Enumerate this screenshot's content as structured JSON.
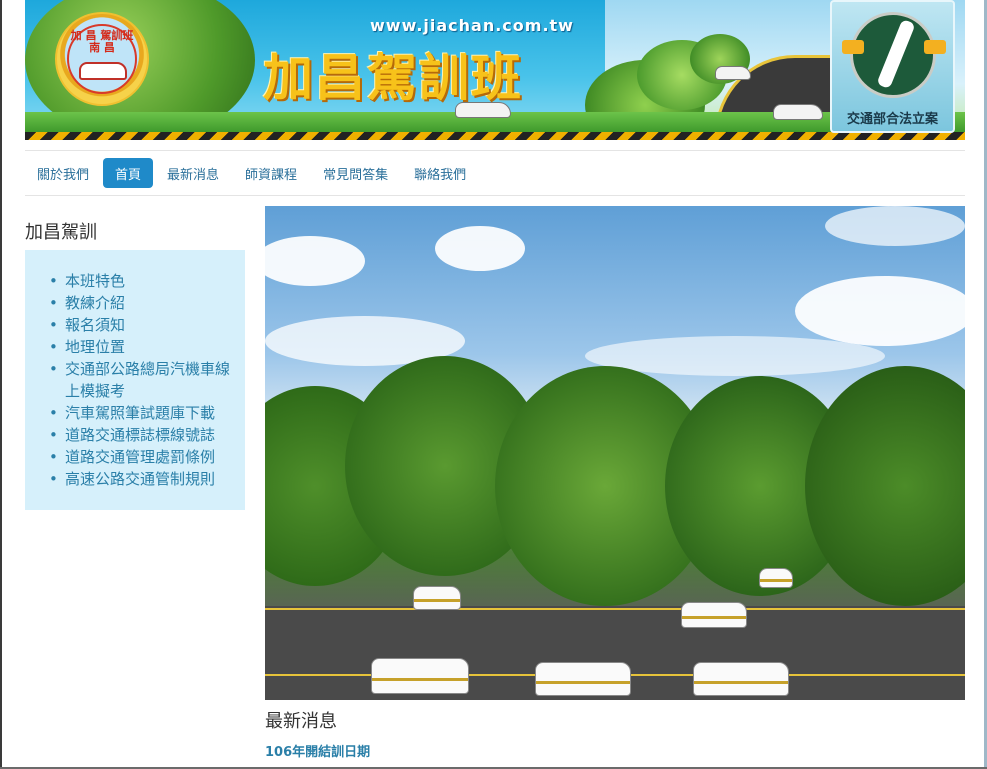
{
  "banner": {
    "url": "www.jiachan.com.tw",
    "title": "加昌駕訓班",
    "seal_text": "加 昌 駕訓班\n南 昌",
    "badge_label": "交通部合法立案"
  },
  "nav": {
    "items": [
      {
        "label": "關於我們",
        "active": false
      },
      {
        "label": "首頁",
        "active": true
      },
      {
        "label": "最新消息",
        "active": false
      },
      {
        "label": "師資課程",
        "active": false
      },
      {
        "label": "常見問答集",
        "active": false
      },
      {
        "label": "聯絡我們",
        "active": false
      }
    ]
  },
  "sidebar": {
    "title": "加昌駕訓",
    "items": [
      {
        "label": "本班特色"
      },
      {
        "label": "教練介紹"
      },
      {
        "label": "報名須知"
      },
      {
        "label": "地理位置"
      },
      {
        "label": "交通部公路總局汽機車線上模擬考"
      },
      {
        "label": "汽車駕照筆試題庫下載"
      },
      {
        "label": "道路交通標誌標線號誌"
      },
      {
        "label": "道路交通管理處罰條例"
      },
      {
        "label": "高速公路交通管制規則"
      }
    ]
  },
  "news": {
    "title": "最新消息",
    "items": [
      {
        "label": "106年開結訓日期"
      }
    ]
  },
  "colors": {
    "accent": "#1f8ac9",
    "link": "#2a7fa8",
    "sidebar_bg": "#d6f0fb"
  }
}
